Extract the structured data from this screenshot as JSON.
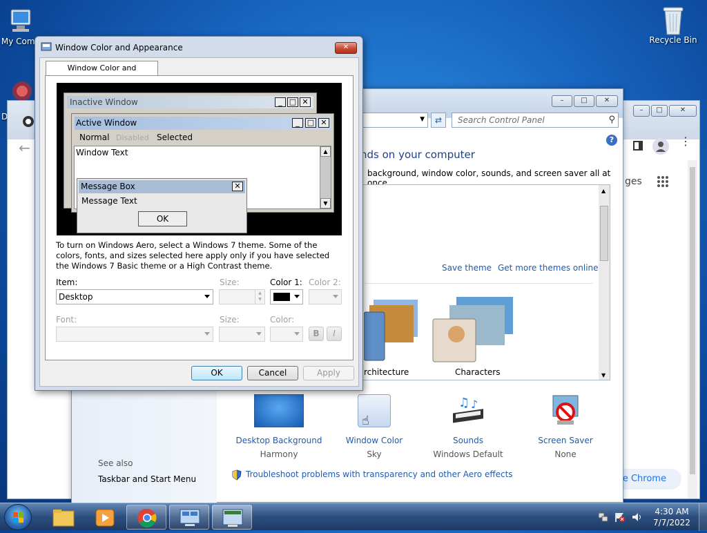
{
  "desktop": {
    "icons": [
      {
        "label": "My Computer",
        "icon": "computer-icon"
      },
      {
        "label": "Recycle Bin",
        "icon": "recycle-bin-icon"
      }
    ],
    "my_computer_visible": "My Comp",
    "d_letter": "D"
  },
  "chrome": {
    "partial_texts": {
      "pages": "ges",
      "chrome_button": "ze Chrome"
    }
  },
  "control_panel": {
    "search_placeholder": "Search Control Panel",
    "heading_partial": "nds on your computer",
    "subheading_partial": "background, window color, sounds, and screen saver all at once.",
    "save_theme": "Save theme",
    "get_more": "Get more themes online",
    "themes": [
      {
        "label": "rchitecture"
      },
      {
        "label": "Characters"
      }
    ],
    "items": [
      {
        "title": "Desktop Background",
        "value": "Harmony"
      },
      {
        "title": "Window Color",
        "value": "Sky"
      },
      {
        "title": "Sounds",
        "value": "Windows Default"
      },
      {
        "title": "Screen Saver",
        "value": "None"
      }
    ],
    "see_also": "See also",
    "taskbar_link": "Taskbar and Start Menu",
    "troubleshoot": "Troubleshoot problems with transparency and other Aero effects"
  },
  "dialog": {
    "title": "Window Color and Appearance",
    "tab": "Window Color and Appearance",
    "preview": {
      "inactive": "Inactive Window",
      "active": "Active Window",
      "menu": [
        "Normal",
        "Disabled",
        "Selected"
      ],
      "window_text": "Window Text",
      "message_box": "Message Box",
      "message_text": "Message Text",
      "ok": "OK"
    },
    "info_text": "To turn on Windows Aero, select a Windows 7 theme.  Some of the colors, fonts, and sizes selected here apply only if you have selected the Windows 7 Basic theme or a High Contrast theme.",
    "item_label": "Item:",
    "item_value": "Desktop",
    "size_label": "Size:",
    "color1_label": "Color 1:",
    "color2_label": "Color 2:",
    "font_label": "Font:",
    "size2_label": "Size:",
    "color_label": "Color:",
    "bold": "B",
    "italic": "I",
    "ok": "OK",
    "cancel": "Cancel",
    "apply": "Apply",
    "color1_value": "#000000"
  },
  "taskbar": {
    "time": "4:30 AM",
    "date": "7/7/2022"
  }
}
